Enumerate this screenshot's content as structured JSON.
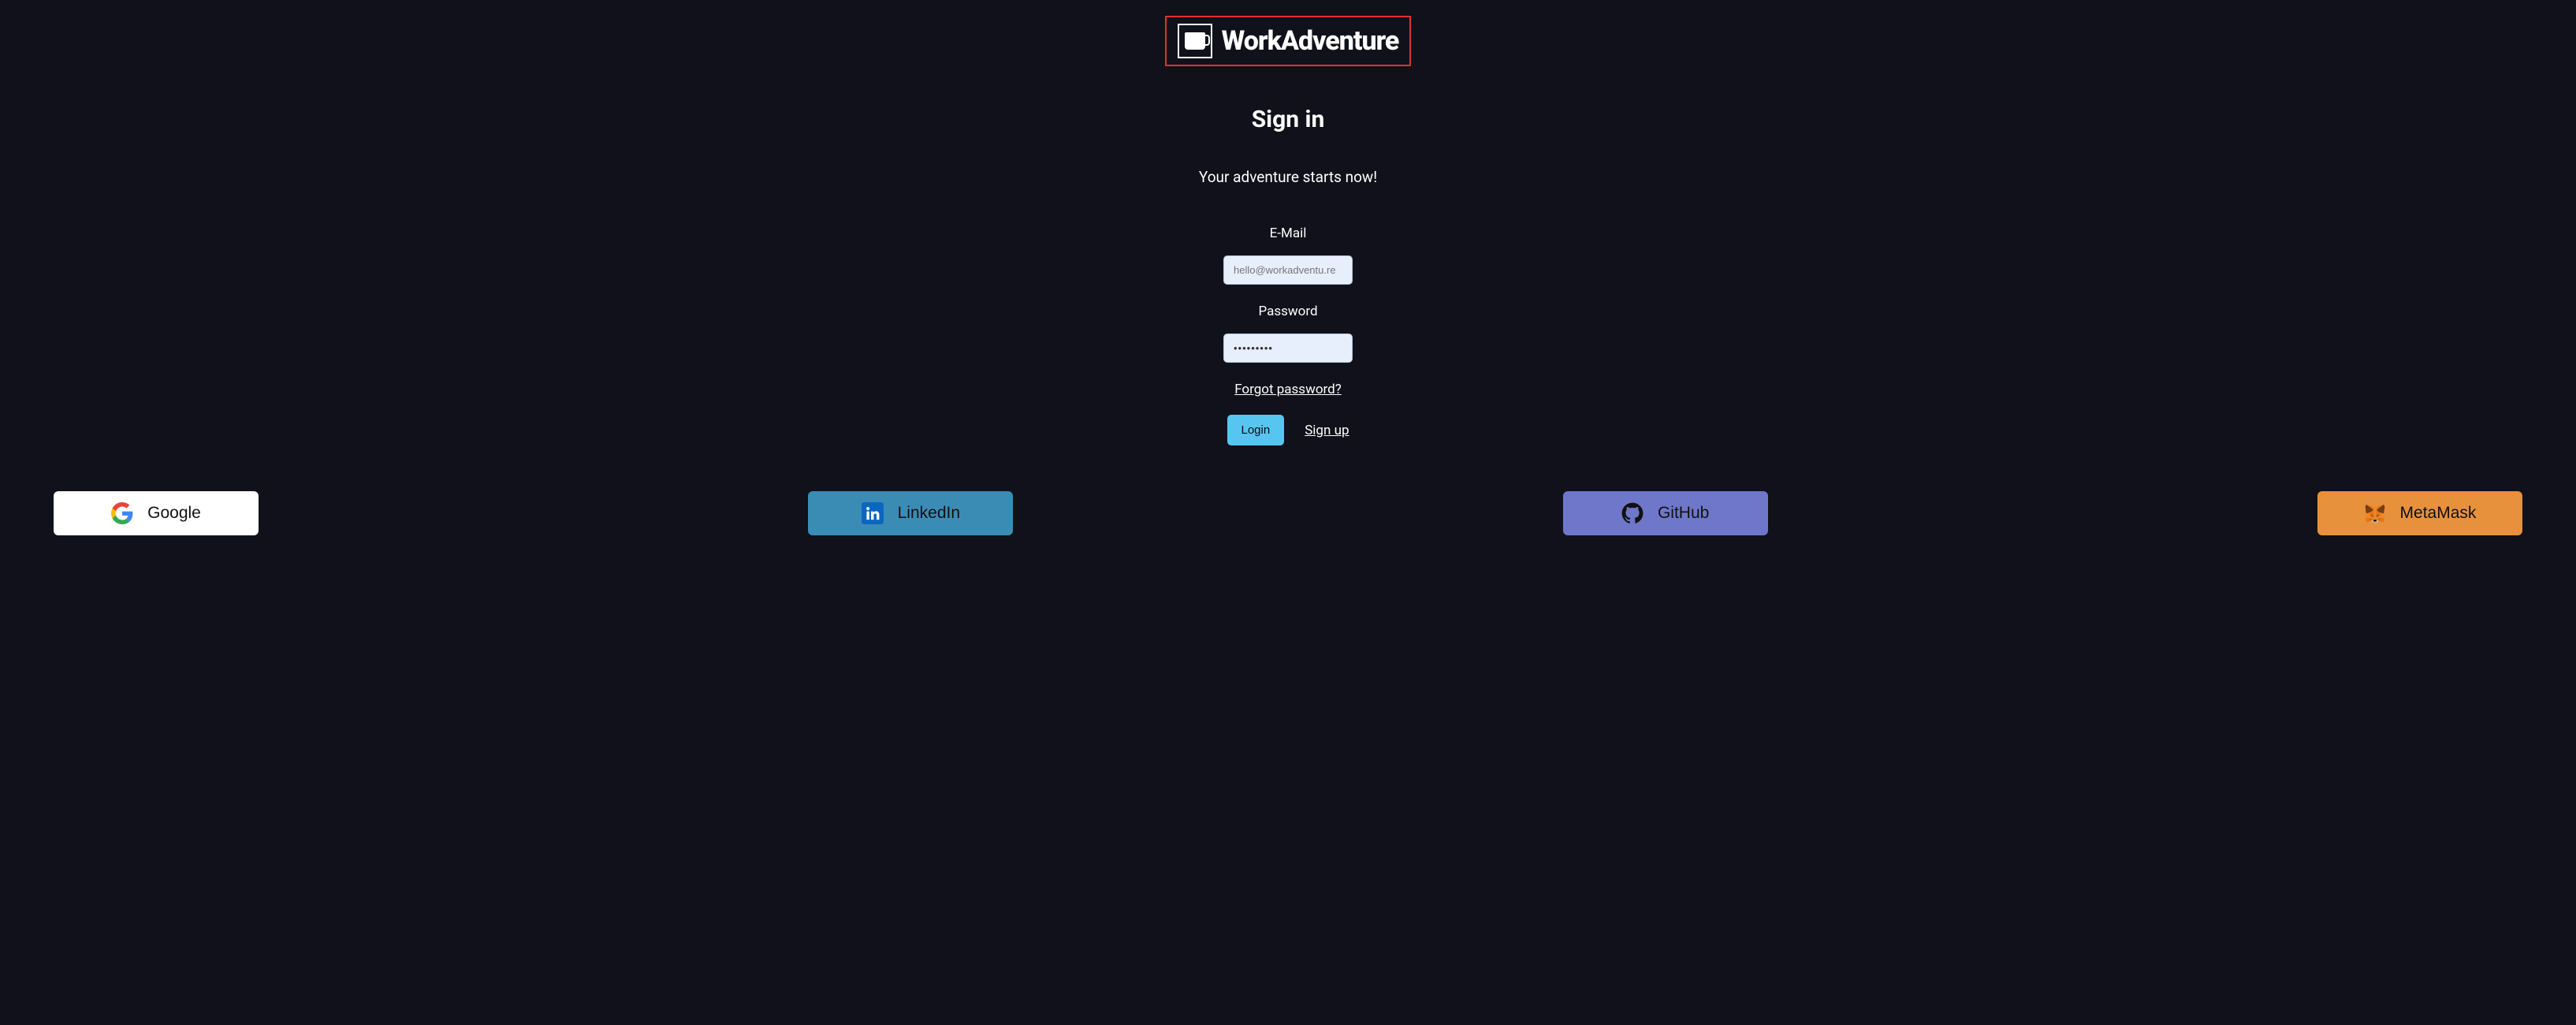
{
  "brand": {
    "name": "WorkAdventure"
  },
  "heading": "Sign in",
  "subtitle": "Your adventure starts now!",
  "form": {
    "email_label": "E-Mail",
    "email_placeholder": "hello@workadventu.re",
    "email_value": "",
    "password_label": "Password",
    "password_value": "•••••••••",
    "forgot_label": "Forgot password?",
    "login_label": "Login",
    "signup_label": "Sign up"
  },
  "social": {
    "google": "Google",
    "linkedin": "LinkedIn",
    "github": "GitHub",
    "metamask": "MetaMask"
  }
}
